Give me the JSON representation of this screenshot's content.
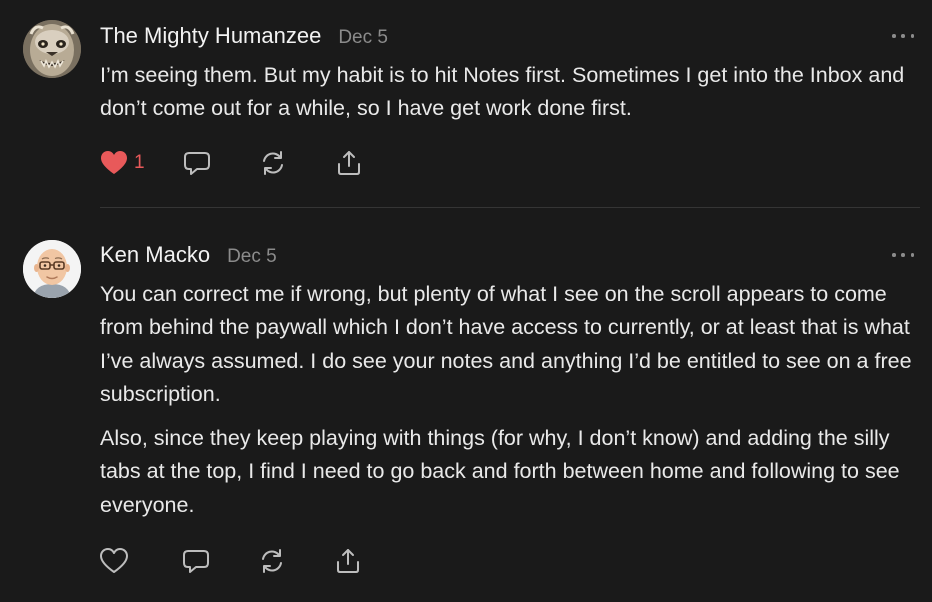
{
  "comments": [
    {
      "author": "The Mighty Humanzee",
      "date": "Dec 5",
      "avatar_icon": "wolf-portrait-avatar",
      "paragraphs": [
        "I’m seeing them. But my habit is to hit Notes first. Sometimes I get into the Inbox and don’t come out for a while, so I have get work done first."
      ],
      "liked": true,
      "like_count": "1"
    },
    {
      "author": "Ken Macko",
      "date": "Dec 5",
      "avatar_icon": "bald-man-glasses-avatar",
      "paragraphs": [
        "You can correct me if wrong, but plenty of what I see on the scroll appears to come from behind the paywall which I don’t have access to currently, or at least that is what I’ve always assumed. I do see your notes and anything I’d be entitled to see on a free subscription.",
        "Also, since they keep playing with things (for why, I don’t know) and adding the silly tabs at the top, I find I need to go back and forth between home and following to see everyone."
      ],
      "liked": false,
      "like_count": ""
    }
  ],
  "icons": {
    "like": "heart-icon",
    "reply": "chat-bubble-icon",
    "restack": "restack-icon",
    "share": "share-icon",
    "more": "more-options-icon"
  },
  "colors": {
    "background": "#1a1a1a",
    "text": "#e9e9e9",
    "muted": "#8b8b8b",
    "like_red": "#e8595a",
    "icon": "#bdbdbd",
    "divider": "#353535"
  }
}
